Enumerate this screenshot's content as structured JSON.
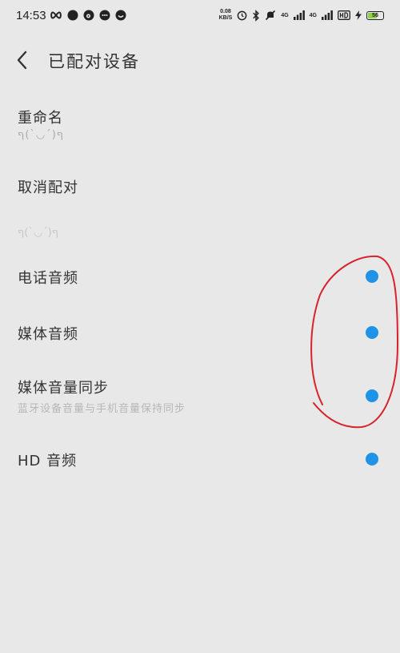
{
  "status_bar": {
    "time": "14:53",
    "net_speed_value": "0.08",
    "net_speed_unit": "KB/S",
    "signal1_label": "4G",
    "signal2_label": "4G",
    "battery_level": "56",
    "battery_fill_fraction": 0.56,
    "battery_color": "#8ed14a"
  },
  "header": {
    "title": "已配对设备"
  },
  "rename": {
    "label": "重命名",
    "value": "ף(ˊ◡ˋ)ף"
  },
  "unpair": {
    "label": "取消配对"
  },
  "section_label": "ף(ˊ◡ˋ)ף",
  "profiles": [
    {
      "label": "电话音频",
      "enabled": true
    },
    {
      "label": "媒体音频",
      "enabled": true
    },
    {
      "label": "媒体音量同步",
      "sublabel": "蓝牙设备音量与手机音量保持同步",
      "enabled": true
    },
    {
      "label": "HD 音频",
      "enabled": true
    }
  ],
  "colors": {
    "accent": "#1f93e8",
    "background": "#e8e8e8",
    "annotation": "#d8232a"
  }
}
